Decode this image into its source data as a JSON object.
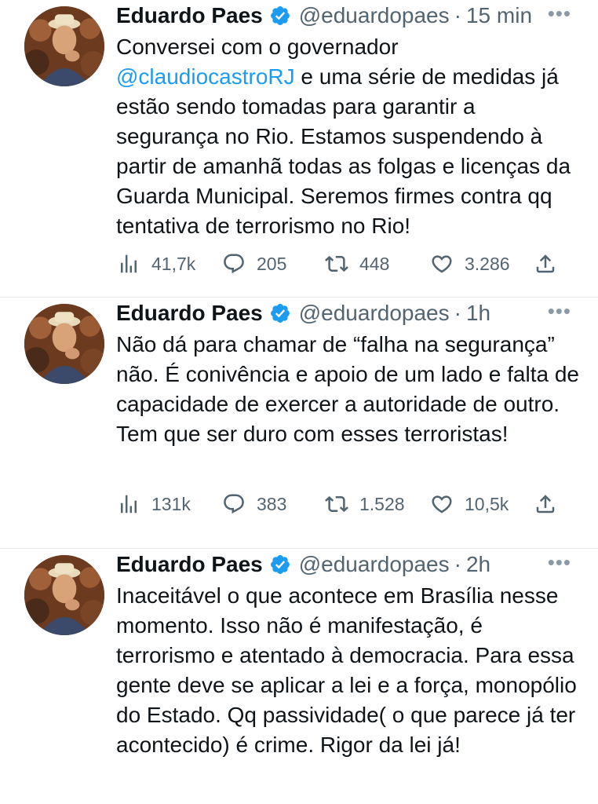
{
  "tweets": [
    {
      "name": "Eduardo Paes",
      "handle": "@eduardopaes",
      "separator": "·",
      "time": "15 min",
      "text_pre": "Conversei com o governador",
      "mention": "@claudiocastroRJ",
      "text_post": " e uma série de medidas já estão sendo tomadas para garantir a segurança no Rio. Estamos suspendendo à partir de amanhã todas as folgas e licenças da Guarda Municipal.  Seremos firmes contra qq tentativa de terrorismo no Rio!",
      "views": "41,7k",
      "replies": "205",
      "retweets": "448",
      "likes": "3.286"
    },
    {
      "name": "Eduardo Paes",
      "handle": "@eduardopaes",
      "separator": "·",
      "time": "1h",
      "text": "Não dá para chamar de “falha na segurança” não.  É conivência e apoio de um lado e falta de capacidade de exercer a autoridade de outro.  Tem que ser duro com esses terroristas!",
      "views": "131k",
      "replies": "383",
      "retweets": "1.528",
      "likes": "10,5k"
    },
    {
      "name": "Eduardo Paes",
      "handle": "@eduardopaes",
      "separator": "·",
      "time": "2h",
      "text": "Inaceitável o que acontece em Brasília nesse momento.  Isso não é manifestação, é terrorismo e atentado à democracia.  Para essa gente deve se aplicar a lei e a força, monopólio do Estado.  Qq passividade( o que parece já ter acontecido) é crime.  Rigor da lei já!"
    }
  ],
  "more_glyph": "•••",
  "colors": {
    "accent": "#1d9bf0",
    "muted": "#536471",
    "text": "#0f1419"
  },
  "icons": [
    "verified-badge-icon",
    "views-icon",
    "reply-icon",
    "retweet-icon",
    "like-icon",
    "share-icon",
    "more-icon"
  ]
}
